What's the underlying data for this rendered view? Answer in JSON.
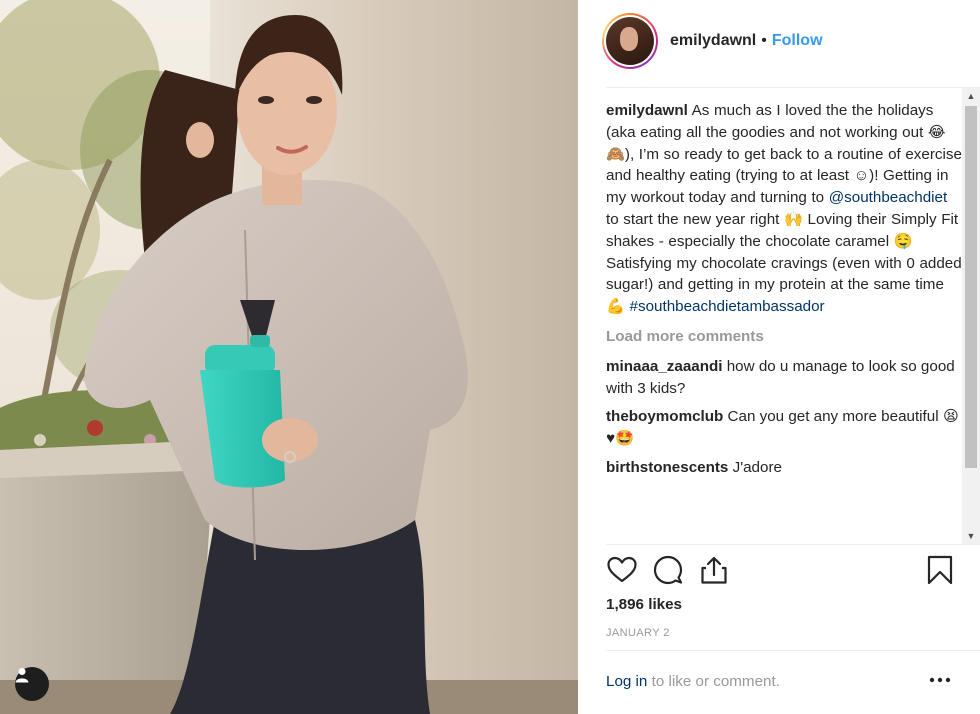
{
  "post": {
    "username": "emilydawnl",
    "follow_separator": "•",
    "follow_label": "Follow",
    "caption": {
      "username": "emilydawnl",
      "text_part1": "As much as I loved the the holidays (aka eating all the goodies and not working out 😂🙈), I’m so ready to get back to a routine of exercise and healthy eating (trying to at least ☺)! Getting in my workout today and turning to",
      "mention": "@southbeachdiet",
      "text_part2": "to start the new year right 🙌 Loving their Simply Fit shakes - especially the chocolate caramel 🤤 Satisfying my chocolate cravings (even with 0 added sugar!) and getting in my protein at the same time 💪",
      "hashtag": "#southbeachdietambassador"
    },
    "load_more_label": "Load more comments",
    "comments": [
      {
        "username": "minaaa_zaaandi",
        "text": "how do u manage to look so good with 3 kids?"
      },
      {
        "username": "theboymomclub",
        "text": "Can you get any more beautiful 😫♥🤩"
      },
      {
        "username": "birthstonescents",
        "text": "J'adore"
      }
    ],
    "likes": "1,896 likes",
    "date": "JANUARY 2",
    "login_link": "Log in",
    "login_text": "to like or comment."
  },
  "icons": {
    "like": "heart-icon",
    "comment": "comment-icon",
    "share": "share-icon",
    "save": "bookmark-icon",
    "more": "more-options-icon",
    "tagged_user": "user-tag-icon"
  },
  "colors": {
    "follow_blue": "#3897f0",
    "link_navy": "#003569",
    "muted_gray": "#999999"
  }
}
